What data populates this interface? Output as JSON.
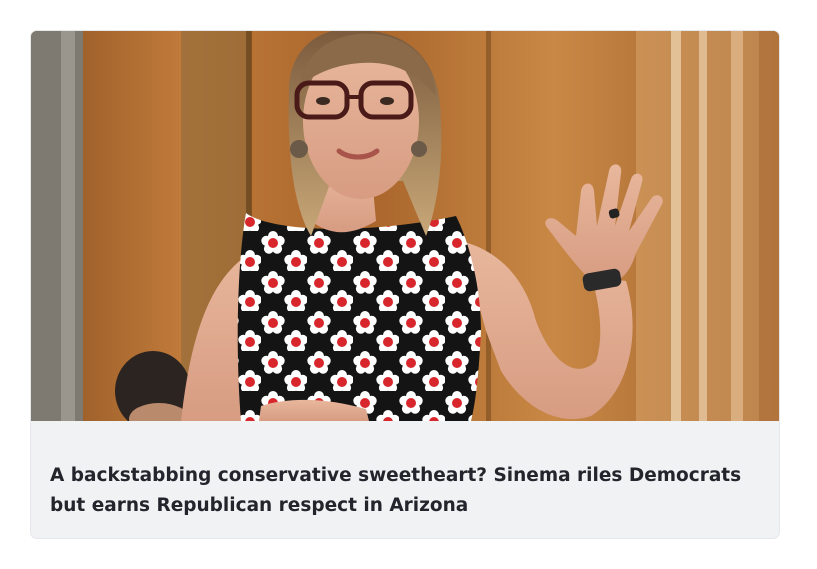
{
  "article": {
    "headline": "A backstabbing conservative sweetheart? Sinema riles Democrats but earns Republican respect in Arizona",
    "image_alt": "Woman with glasses in a black sleeveless dress with white and red flower print, raising her hand in front of a wood-paneled wall"
  },
  "colors": {
    "card_background": "#f1f2f4",
    "headline_text": "#22252b",
    "wood_panel": "#b06a2c",
    "dress": "#141414",
    "flower_petal": "#ffffff",
    "flower_center": "#d8262d"
  }
}
